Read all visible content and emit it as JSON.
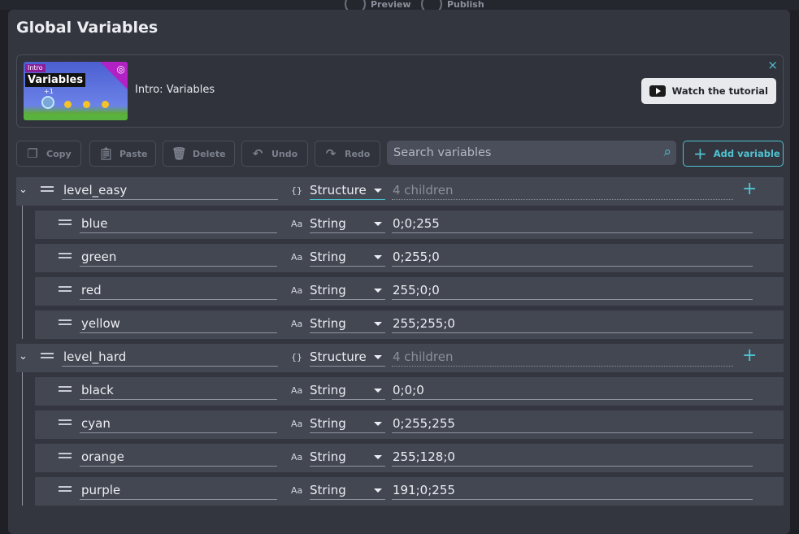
{
  "topbar": {
    "preview_label": "Preview",
    "publish_label": "Publish"
  },
  "dialog": {
    "title": "Global Variables"
  },
  "tutorial": {
    "thumb_tag": "Intro",
    "thumb_title": "Variables",
    "thumb_plus": "+1",
    "label": "Intro: Variables",
    "watch_label": "Watch the tutorial",
    "close_icon": "×"
  },
  "toolbar": {
    "copy": "Copy",
    "paste": "Paste",
    "delete": "Delete",
    "undo": "Undo",
    "redo": "Redo",
    "search_placeholder": "Search variables",
    "add_variable": "Add variable"
  },
  "accent_color": "#4fc3d1",
  "variables": [
    {
      "name": "level_easy",
      "type": "Structure",
      "type_icon": "{}",
      "summary": "4 children",
      "children": [
        {
          "name": "blue",
          "type": "String",
          "type_icon": "Aa",
          "value": "0;0;255"
        },
        {
          "name": "green",
          "type": "String",
          "type_icon": "Aa",
          "value": "0;255;0"
        },
        {
          "name": "red",
          "type": "String",
          "type_icon": "Aa",
          "value": "255;0;0"
        },
        {
          "name": "yellow",
          "type": "String",
          "type_icon": "Aa",
          "value": "255;255;0"
        }
      ]
    },
    {
      "name": "level_hard",
      "type": "Structure",
      "type_icon": "{}",
      "summary": "4 children",
      "children": [
        {
          "name": "black",
          "type": "String",
          "type_icon": "Aa",
          "value": "0;0;0"
        },
        {
          "name": "cyan",
          "type": "String",
          "type_icon": "Aa",
          "value": "0;255;255"
        },
        {
          "name": "orange",
          "type": "String",
          "type_icon": "Aa",
          "value": "255;128;0"
        },
        {
          "name": "purple",
          "type": "String",
          "type_icon": "Aa",
          "value": "191;0;255"
        }
      ]
    }
  ]
}
